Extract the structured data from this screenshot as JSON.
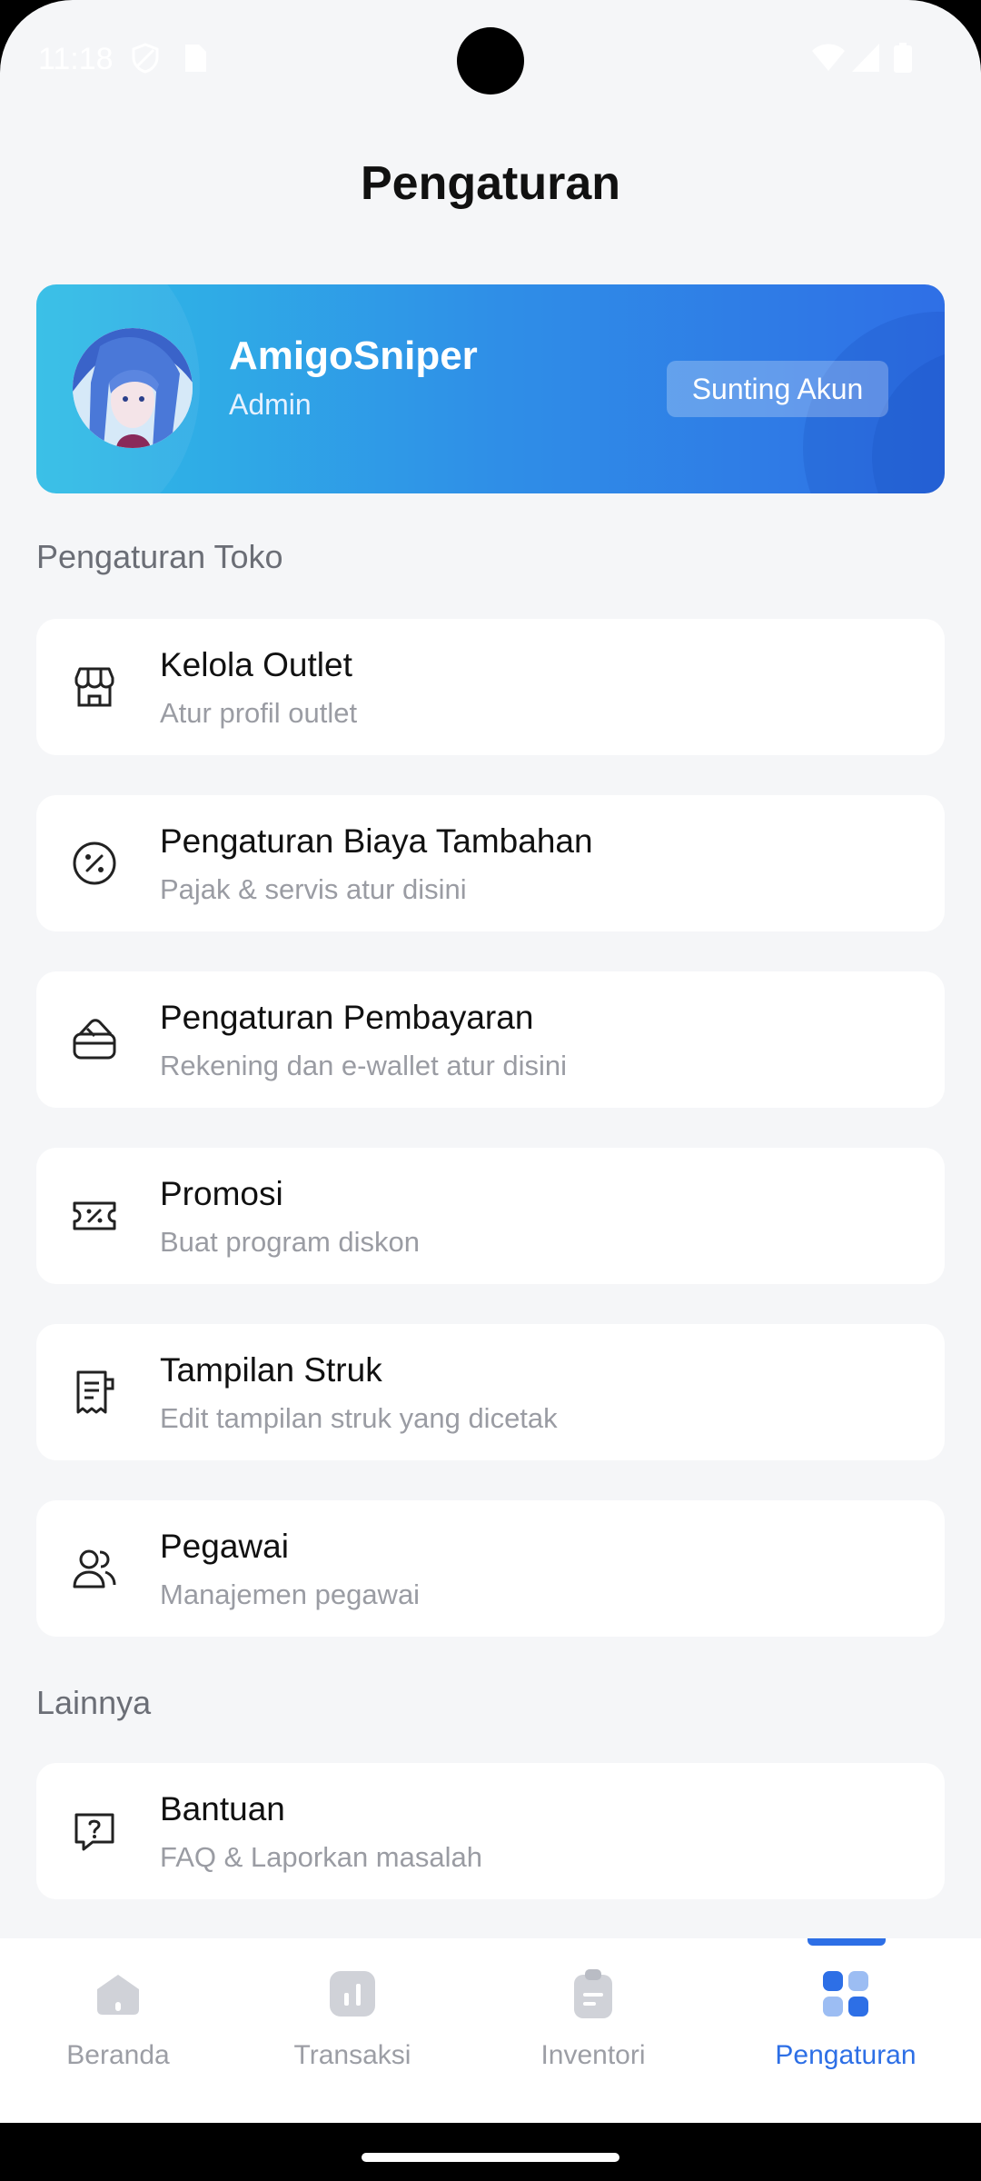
{
  "status_bar": {
    "time": "11:18"
  },
  "header": {
    "title": "Pengaturan"
  },
  "profile": {
    "name": "AmigoSniper",
    "role": "Admin",
    "edit_label": "Sunting Akun"
  },
  "sections": {
    "store": "Pengaturan Toko",
    "other": "Lainnya"
  },
  "store_items": [
    {
      "title": "Kelola Outlet",
      "subtitle": "Atur profil outlet",
      "icon": "store-icon"
    },
    {
      "title": "Pengaturan Biaya Tambahan",
      "subtitle": "Pajak & servis atur disini",
      "icon": "percent-icon"
    },
    {
      "title": "Pengaturan Pembayaran",
      "subtitle": "Rekening dan e-wallet atur disini",
      "icon": "wallet-icon"
    },
    {
      "title": "Promosi",
      "subtitle": "Buat program diskon",
      "icon": "discount-ticket-icon"
    },
    {
      "title": "Tampilan Struk",
      "subtitle": "Edit tampilan struk yang dicetak",
      "icon": "receipt-icon"
    },
    {
      "title": "Pegawai",
      "subtitle": "Manajemen pegawai",
      "icon": "users-icon"
    }
  ],
  "other_items": [
    {
      "title": "Bantuan",
      "subtitle": "FAQ & Laporkan masalah",
      "icon": "help-chat-icon"
    }
  ],
  "bottom_nav": [
    {
      "label": "Beranda",
      "icon": "home-icon"
    },
    {
      "label": "Transaksi",
      "icon": "chart-icon"
    },
    {
      "label": "Inventori",
      "icon": "clipboard-icon"
    },
    {
      "label": "Pengaturan",
      "icon": "grid-icon",
      "active": true
    }
  ],
  "colors": {
    "accent": "#2d6fe6",
    "background": "#f5f6f8",
    "card": "#ffffff",
    "inactive_nav": "#9c9ea5"
  }
}
